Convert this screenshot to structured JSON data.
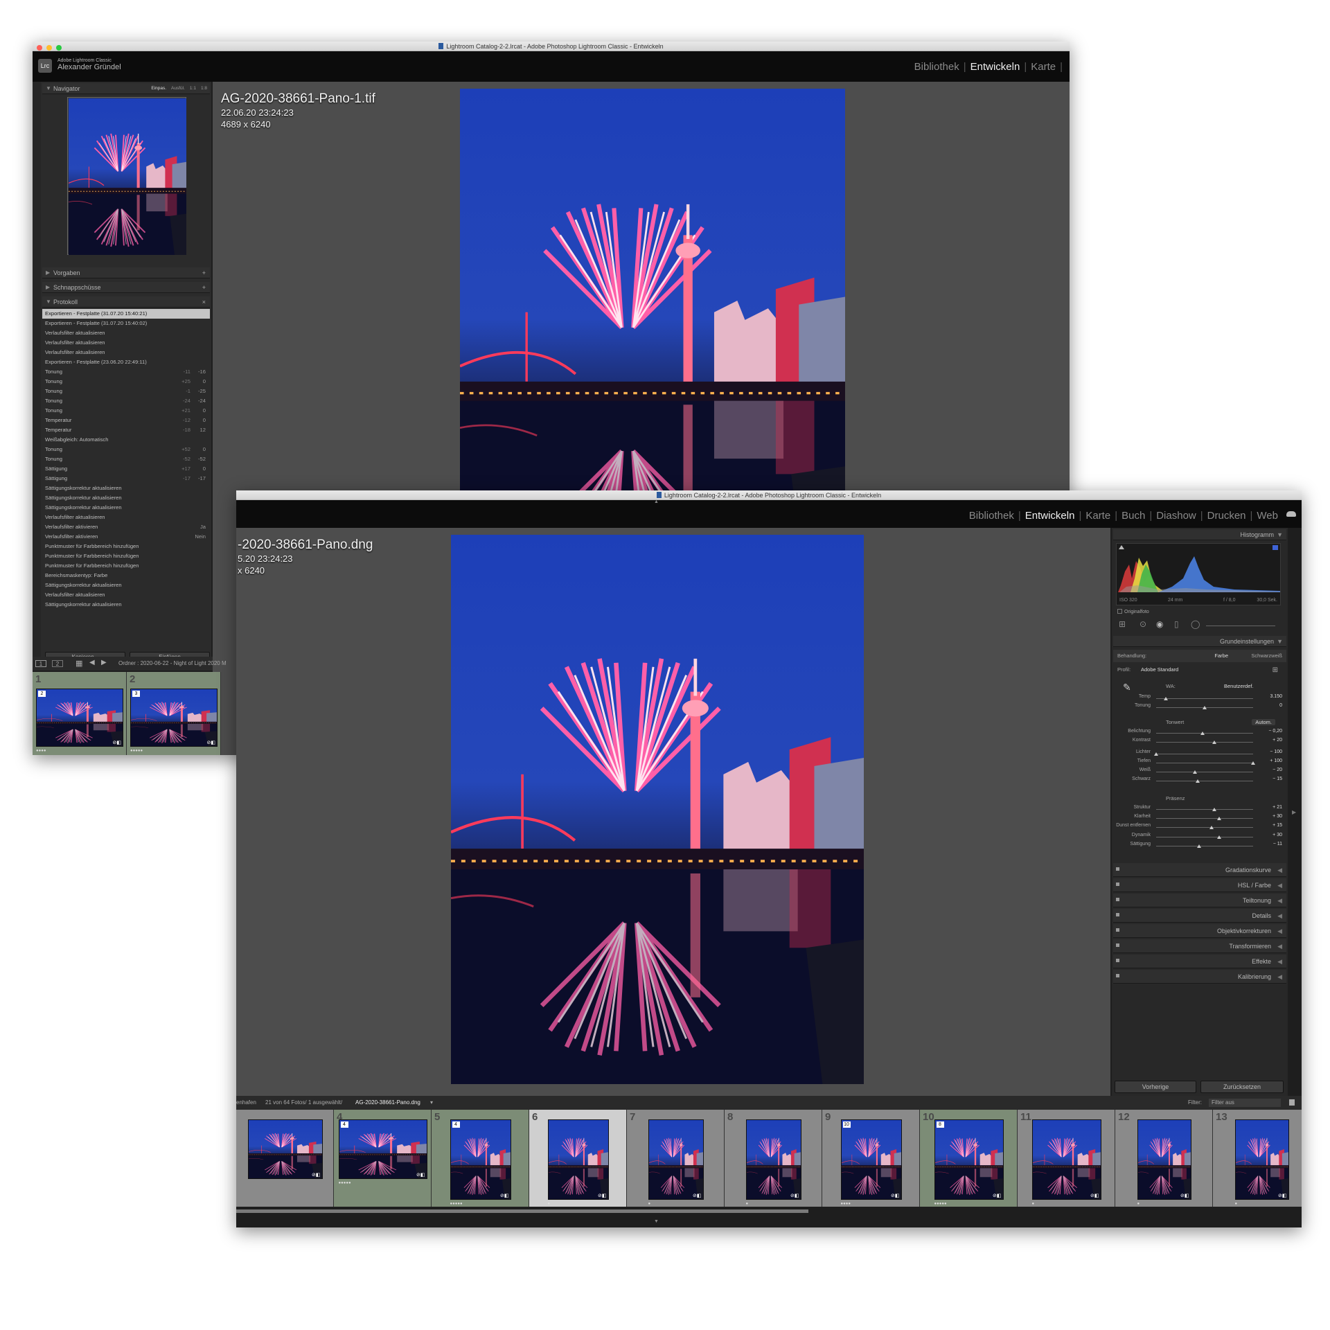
{
  "back_window": {
    "title": "Lightroom Catalog-2-2.lrcat - Adobe Photoshop Lightroom Classic - Entwickeln",
    "identity": {
      "product": "Adobe Lightroom Classic",
      "user": "Alexander Gründel"
    },
    "modules": [
      {
        "label": "Bibliothek",
        "active": false
      },
      {
        "label": "Entwickeln",
        "active": true
      },
      {
        "label": "Karte",
        "active": false
      }
    ],
    "photo_info": {
      "filename": "AG-2020-38661-Pano-1.tif",
      "date": "22.06.20 23:24:23",
      "dimensions": "4689 x 6240"
    },
    "navigator": {
      "label": "Navigator",
      "zoom_options": [
        "Einpas.",
        "Ausfül.",
        "1:1",
        "1:8"
      ]
    },
    "panels": {
      "presets": "Vorgaben",
      "snapshots": "Schnappschüsse",
      "history": "Protokoll"
    },
    "history": [
      {
        "label": "Exportieren - Festplatte (31.07.20 15:40:21)",
        "a": "",
        "b": "",
        "selected": true
      },
      {
        "label": "Exportieren - Festplatte (31.07.20 15:40:02)",
        "a": "",
        "b": ""
      },
      {
        "label": "Verlaufsfilter aktualisieren",
        "a": "",
        "b": ""
      },
      {
        "label": "Verlaufsfilter aktualisieren",
        "a": "",
        "b": ""
      },
      {
        "label": "Verlaufsfilter aktualisieren",
        "a": "",
        "b": ""
      },
      {
        "label": "Exportieren - Festplatte (23.06.20 22:49:11)",
        "a": "",
        "b": ""
      },
      {
        "label": "Tonung",
        "a": "-11",
        "b": "-16"
      },
      {
        "label": "Tonung",
        "a": "+25",
        "b": "0"
      },
      {
        "label": "Tonung",
        "a": "-1",
        "b": "-25"
      },
      {
        "label": "Tonung",
        "a": "-24",
        "b": "-24"
      },
      {
        "label": "Tonung",
        "a": "+21",
        "b": "0"
      },
      {
        "label": "Temperatur",
        "a": "-12",
        "b": "0"
      },
      {
        "label": "Temperatur",
        "a": "-18",
        "b": "12"
      },
      {
        "label": "Weißabgleich: Automatisch",
        "a": "",
        "b": ""
      },
      {
        "label": "Tonung",
        "a": "+52",
        "b": "0"
      },
      {
        "label": "Tonung",
        "a": "-52",
        "b": "-52"
      },
      {
        "label": "Sättigung",
        "a": "+17",
        "b": "0"
      },
      {
        "label": "Sättigung",
        "a": "-17",
        "b": "-17"
      },
      {
        "label": "Sättigungskorrektur aktualisieren",
        "a": "",
        "b": ""
      },
      {
        "label": "Sättigungskorrektur aktualisieren",
        "a": "",
        "b": ""
      },
      {
        "label": "Sättigungskorrektur aktualisieren",
        "a": "",
        "b": ""
      },
      {
        "label": "Verlaufsfilter aktualisieren",
        "a": "",
        "b": ""
      },
      {
        "label": "Verlaufsfilter aktivieren",
        "a": "",
        "b": "Ja"
      },
      {
        "label": "Verlaufsfilter aktivieren",
        "a": "",
        "b": "Nein"
      },
      {
        "label": "Punktmuster für Farbbereich hinzufügen",
        "a": "",
        "b": ""
      },
      {
        "label": "Punktmuster für Farbbereich hinzufügen",
        "a": "",
        "b": ""
      },
      {
        "label": "Punktmuster für Farbbereich hinzufügen",
        "a": "",
        "b": ""
      },
      {
        "label": "Bereichsmaskentyp: Farbe",
        "a": "",
        "b": ""
      },
      {
        "label": "Sättigungskorrektur aktualisieren",
        "a": "",
        "b": ""
      },
      {
        "label": "Verlaufsfilter aktualisieren",
        "a": "",
        "b": ""
      },
      {
        "label": "Sättigungskorrektur aktualisieren",
        "a": "",
        "b": ""
      }
    ],
    "copy_button": "Kopieren...",
    "paste_button": "Einfügen",
    "filmstrip_bar": {
      "screen1": "1",
      "screen2": "2",
      "folder": "Ordner : 2020-06-22 - Night of Light 2020 M"
    },
    "filmstrip": [
      {
        "num": "1",
        "badge": "2",
        "stars": "●●●●"
      },
      {
        "num": "2",
        "badge": "3",
        "stars": "●●●●●"
      }
    ]
  },
  "front_window": {
    "title": "Lightroom Catalog-2-2.lrcat - Adobe Photoshop Lightroom Classic - Entwickeln",
    "modules": [
      {
        "label": "Bibliothek",
        "active": false
      },
      {
        "label": "Entwickeln",
        "active": true
      },
      {
        "label": "Karte",
        "active": false
      },
      {
        "label": "Buch",
        "active": false
      },
      {
        "label": "Diashow",
        "active": false
      },
      {
        "label": "Drucken",
        "active": false
      },
      {
        "label": "Web",
        "active": false
      }
    ],
    "photo_info": {
      "filename": "-2020-38661-Pano.dng",
      "date": "5.20 23:24:23",
      "dimensions": "x 6240"
    },
    "histogram": {
      "label": "Histogramm",
      "iso": "ISO 320",
      "focal": "24 mm",
      "aperture": "f / 8,0",
      "shutter": "30,0 Sek.",
      "original": "Originalfoto"
    },
    "basic": {
      "label": "Grundeinstellungen",
      "treatment_label": "Behandlung:",
      "treatment_color": "Farbe",
      "treatment_bw": "Schwarzweiß",
      "profile_label": "Profil:",
      "profile_value": "Adobe Standard",
      "wb_label": "WA:",
      "wb_value": "Benutzerdef.",
      "tone_label": "Tonwert",
      "auto": "Autom.",
      "presence_label": "Präsenz",
      "sliders_wb": [
        {
          "label": "Temp",
          "value": "3.150",
          "pos": 0.1
        },
        {
          "label": "Tonung",
          "value": "0",
          "pos": 0.5
        }
      ],
      "sliders_tone1": [
        {
          "label": "Belichtung",
          "value": "− 0,20",
          "pos": 0.48
        },
        {
          "label": "Kontrast",
          "value": "+ 20",
          "pos": 0.6
        }
      ],
      "sliders_tone2": [
        {
          "label": "Lichter",
          "value": "− 100",
          "pos": 0.0
        },
        {
          "label": "Tiefen",
          "value": "+ 100",
          "pos": 1.0
        },
        {
          "label": "Weiß",
          "value": "− 20",
          "pos": 0.4
        },
        {
          "label": "Schwarz",
          "value": "− 15",
          "pos": 0.43
        }
      ],
      "sliders_presence1": [
        {
          "label": "Struktur",
          "value": "+ 21",
          "pos": 0.6
        },
        {
          "label": "Klarheit",
          "value": "+ 30",
          "pos": 0.65
        },
        {
          "label": "Dunst entfernen",
          "value": "+ 15",
          "pos": 0.57
        }
      ],
      "sliders_presence2": [
        {
          "label": "Dynamik",
          "value": "+ 30",
          "pos": 0.65
        },
        {
          "label": "Sättigung",
          "value": "− 11",
          "pos": 0.44
        }
      ]
    },
    "sections": [
      "Gradationskurve",
      "HSL / Farbe",
      "Teiltonung",
      "Details",
      "Objektivkorrekturen",
      "Transformieren",
      "Effekte",
      "Kalibrierung"
    ],
    "prev_button": "Vorherige",
    "reset_button": "Zurücksetzen",
    "filmstrip_bar": {
      "path_prefix": "enhafen",
      "count": "21 von 64 Fotos/ 1 ausgewählt/",
      "selected_file": "AG-2020-38661-Pano.dng",
      "filter_label": "Filter:",
      "filter_value": "Filter aus"
    },
    "filmstrip": [
      {
        "num": "",
        "badge": "",
        "stars": ""
      },
      {
        "num": "4",
        "badge": "4",
        "stars": "●●●●●"
      },
      {
        "num": "5",
        "badge": "4",
        "stars": "●●●●●"
      },
      {
        "num": "6",
        "badge": "",
        "stars": "●"
      },
      {
        "num": "7",
        "badge": "",
        "stars": "●"
      },
      {
        "num": "8",
        "badge": "",
        "stars": "●"
      },
      {
        "num": "9",
        "badge": "10",
        "stars": "●●●●"
      },
      {
        "num": "10",
        "badge": "8",
        "stars": "●●●●●"
      },
      {
        "num": "11",
        "badge": "",
        "stars": "●"
      },
      {
        "num": "12",
        "badge": "",
        "stars": "●"
      },
      {
        "num": "13",
        "badge": "",
        "stars": "●"
      }
    ]
  }
}
